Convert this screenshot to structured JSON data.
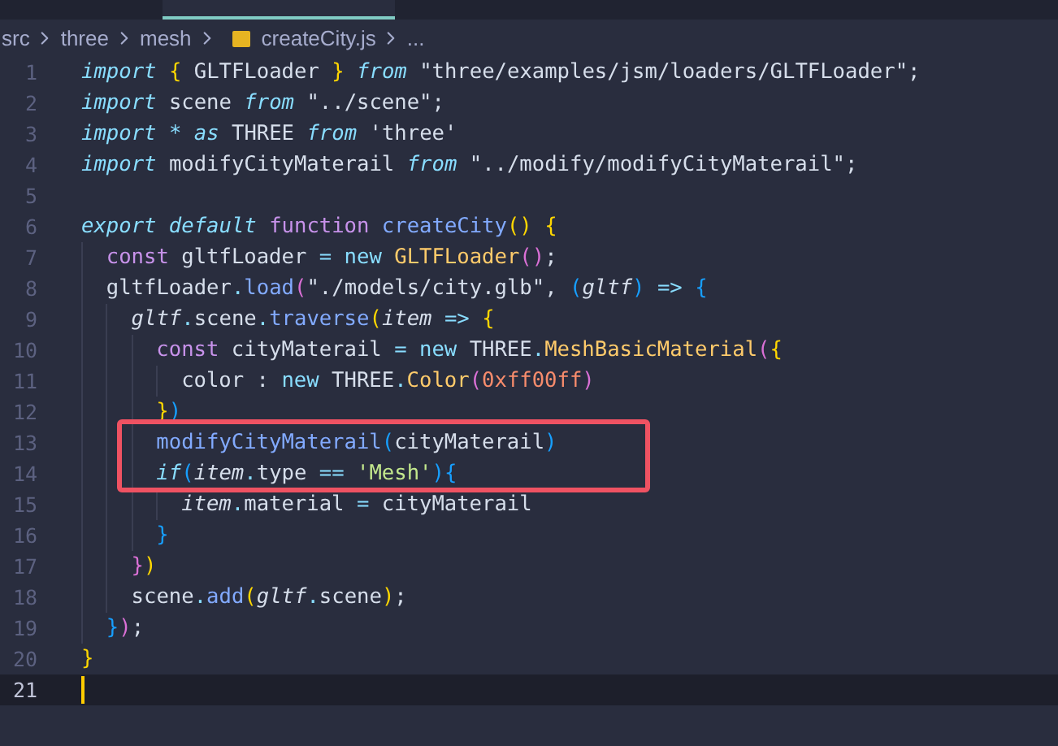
{
  "breadcrumb": {
    "items": [
      {
        "label": "src",
        "kind": "folder"
      },
      {
        "label": "three",
        "kind": "folder"
      },
      {
        "label": "mesh",
        "kind": "folder"
      },
      {
        "label": "createCity.js",
        "kind": "file"
      },
      {
        "label": "...",
        "kind": "more"
      }
    ]
  },
  "editor": {
    "lines": [
      {
        "number": "1",
        "current": false,
        "tokens": [
          {
            "kind": "kw",
            "text": "import"
          },
          {
            "kind": "b1",
            "text": " { "
          },
          {
            "kind": "p",
            "text": "GLTFLoader"
          },
          {
            "kind": "b1",
            "text": " } "
          },
          {
            "kind": "kw",
            "text": "from"
          },
          {
            "kind": "p",
            "text": " \"three/examples/jsm/loaders/GLTFLoader\";"
          }
        ]
      },
      {
        "number": "2",
        "current": false,
        "tokens": [
          {
            "kind": "kw",
            "text": "import"
          },
          {
            "kind": "p",
            "text": " scene "
          },
          {
            "kind": "kw",
            "text": "from"
          },
          {
            "kind": "p",
            "text": " \"../scene\";"
          }
        ]
      },
      {
        "number": "3",
        "current": false,
        "tokens": [
          {
            "kind": "kw",
            "text": "import"
          },
          {
            "kind": "op",
            "text": " * "
          },
          {
            "kind": "kw",
            "text": "as"
          },
          {
            "kind": "p",
            "text": " THREE "
          },
          {
            "kind": "kw",
            "text": "from"
          },
          {
            "kind": "p",
            "text": " 'three'"
          }
        ]
      },
      {
        "number": "4",
        "current": false,
        "tokens": [
          {
            "kind": "kw",
            "text": "import"
          },
          {
            "kind": "p",
            "text": " modifyCityMaterail "
          },
          {
            "kind": "kw",
            "text": "from"
          },
          {
            "kind": "p",
            "text": " \"../modify/modifyCityMaterail\";"
          }
        ]
      },
      {
        "number": "5",
        "current": false
      },
      {
        "number": "6",
        "current": false,
        "tokens": [
          {
            "kind": "kw",
            "text": "export default"
          },
          {
            "kind": "st",
            "text": " function"
          },
          {
            "kind": "fn",
            "text": " createCity"
          },
          {
            "kind": "b1",
            "text": "() {"
          }
        ],
        "children": [
          {
            "number": "7",
            "current": false,
            "tokens": [
              {
                "kind": "st",
                "text": "const"
              },
              {
                "kind": "p",
                "text": " gltfLoader "
              },
              {
                "kind": "op",
                "text": "= new"
              },
              {
                "kind": "ty",
                "text": " GLTFLoader"
              },
              {
                "kind": "b2",
                "text": "()"
              },
              {
                "kind": "p",
                "text": ";"
              }
            ]
          },
          {
            "number": "8",
            "current": false,
            "tokens": [
              {
                "kind": "p",
                "text": "gltfLoader"
              },
              {
                "kind": "op",
                "text": "."
              },
              {
                "kind": "fn",
                "text": "load"
              },
              {
                "kind": "b2",
                "text": "("
              },
              {
                "kind": "p",
                "text": "\"./models/city.glb\","
              },
              {
                "kind": "b3",
                "text": " ("
              },
              {
                "kind": "param",
                "text": "gltf"
              },
              {
                "kind": "b3",
                "text": ")"
              },
              {
                "kind": "op",
                "text": " =>"
              },
              {
                "kind": "b3",
                "text": " {"
              }
            ],
            "children": [
              {
                "number": "9",
                "current": false,
                "tokens": [
                  {
                    "kind": "param",
                    "text": "gltf"
                  },
                  {
                    "kind": "op",
                    "text": "."
                  },
                  {
                    "kind": "p",
                    "text": "scene"
                  },
                  {
                    "kind": "op",
                    "text": "."
                  },
                  {
                    "kind": "fn",
                    "text": "traverse"
                  },
                  {
                    "kind": "b1",
                    "text": "("
                  },
                  {
                    "kind": "param",
                    "text": "item"
                  },
                  {
                    "kind": "op",
                    "text": " =>"
                  },
                  {
                    "kind": "b1",
                    "text": " {"
                  }
                ],
                "children": [
                  {
                    "number": "10",
                    "current": false,
                    "tokens": [
                      {
                        "kind": "st",
                        "text": "const"
                      },
                      {
                        "kind": "p",
                        "text": " cityMaterail "
                      },
                      {
                        "kind": "op",
                        "text": "= new"
                      },
                      {
                        "kind": "p",
                        "text": " THREE"
                      },
                      {
                        "kind": "op",
                        "text": "."
                      },
                      {
                        "kind": "ty",
                        "text": "MeshBasicMaterial"
                      },
                      {
                        "kind": "b2",
                        "text": "("
                      },
                      {
                        "kind": "b1",
                        "text": "{"
                      }
                    ],
                    "children": [
                      {
                        "number": "11",
                        "current": false,
                        "tokens": [
                          {
                            "kind": "p",
                            "text": "color : "
                          },
                          {
                            "kind": "op",
                            "text": "new"
                          },
                          {
                            "kind": "p",
                            "text": " THREE"
                          },
                          {
                            "kind": "op",
                            "text": "."
                          },
                          {
                            "kind": "ty",
                            "text": "Color"
                          },
                          {
                            "kind": "b2",
                            "text": "("
                          },
                          {
                            "kind": "num",
                            "text": "0xff00ff"
                          },
                          {
                            "kind": "b2",
                            "text": ")"
                          }
                        ]
                      }
                    ]
                  },
                  {
                    "number": "12",
                    "current": false,
                    "tokens": [
                      {
                        "kind": "b1",
                        "text": "}"
                      },
                      {
                        "kind": "b3",
                        "text": ")"
                      }
                    ]
                  },
                  {
                    "number": "13",
                    "current": false,
                    "tokens": [
                      {
                        "kind": "fn",
                        "text": "modifyCityMaterail"
                      },
                      {
                        "kind": "b3",
                        "text": "("
                      },
                      {
                        "kind": "p",
                        "text": "cityMaterail"
                      },
                      {
                        "kind": "b3",
                        "text": ")"
                      }
                    ]
                  },
                  {
                    "number": "14",
                    "current": false,
                    "tokens": [
                      {
                        "kind": "kw",
                        "text": "if"
                      },
                      {
                        "kind": "b3",
                        "text": "("
                      },
                      {
                        "kind": "param",
                        "text": "item"
                      },
                      {
                        "kind": "op",
                        "text": "."
                      },
                      {
                        "kind": "p",
                        "text": "type "
                      },
                      {
                        "kind": "op",
                        "text": "=="
                      },
                      {
                        "kind": "str",
                        "text": " 'Mesh'"
                      },
                      {
                        "kind": "b3",
                        "text": "){"
                      }
                    ],
                    "children": [
                      {
                        "number": "15",
                        "current": false,
                        "tokens": [
                          {
                            "kind": "param",
                            "text": "item"
                          },
                          {
                            "kind": "op",
                            "text": "."
                          },
                          {
                            "kind": "p",
                            "text": "material "
                          },
                          {
                            "kind": "op",
                            "text": "="
                          },
                          {
                            "kind": "p",
                            "text": " cityMaterail"
                          }
                        ]
                      }
                    ]
                  },
                  {
                    "number": "16",
                    "current": false,
                    "tokens": [
                      {
                        "kind": "b3",
                        "text": "}"
                      }
                    ]
                  }
                ]
              },
              {
                "number": "17",
                "current": false,
                "tokens": [
                  {
                    "kind": "b2",
                    "text": "}"
                  },
                  {
                    "kind": "b1",
                    "text": ")"
                  }
                ]
              },
              {
                "number": "18",
                "current": false,
                "tokens": [
                  {
                    "kind": "p",
                    "text": "scene"
                  },
                  {
                    "kind": "op",
                    "text": "."
                  },
                  {
                    "kind": "fn",
                    "text": "add"
                  },
                  {
                    "kind": "b1",
                    "text": "("
                  },
                  {
                    "kind": "param",
                    "text": "gltf"
                  },
                  {
                    "kind": "op",
                    "text": "."
                  },
                  {
                    "kind": "p",
                    "text": "scene"
                  },
                  {
                    "kind": "b1",
                    "text": ")"
                  },
                  {
                    "kind": "p",
                    "text": ";"
                  }
                ]
              }
            ]
          },
          {
            "number": "19",
            "current": false,
            "tokens": [
              {
                "kind": "b3",
                "text": "}"
              },
              {
                "kind": "b2",
                "text": ")"
              },
              {
                "kind": "p",
                "text": ";"
              }
            ]
          }
        ]
      },
      {
        "number": "20",
        "current": false,
        "tokens": [
          {
            "kind": "b1",
            "text": "}"
          }
        ]
      },
      {
        "number": "21",
        "current": true
      }
    ]
  }
}
